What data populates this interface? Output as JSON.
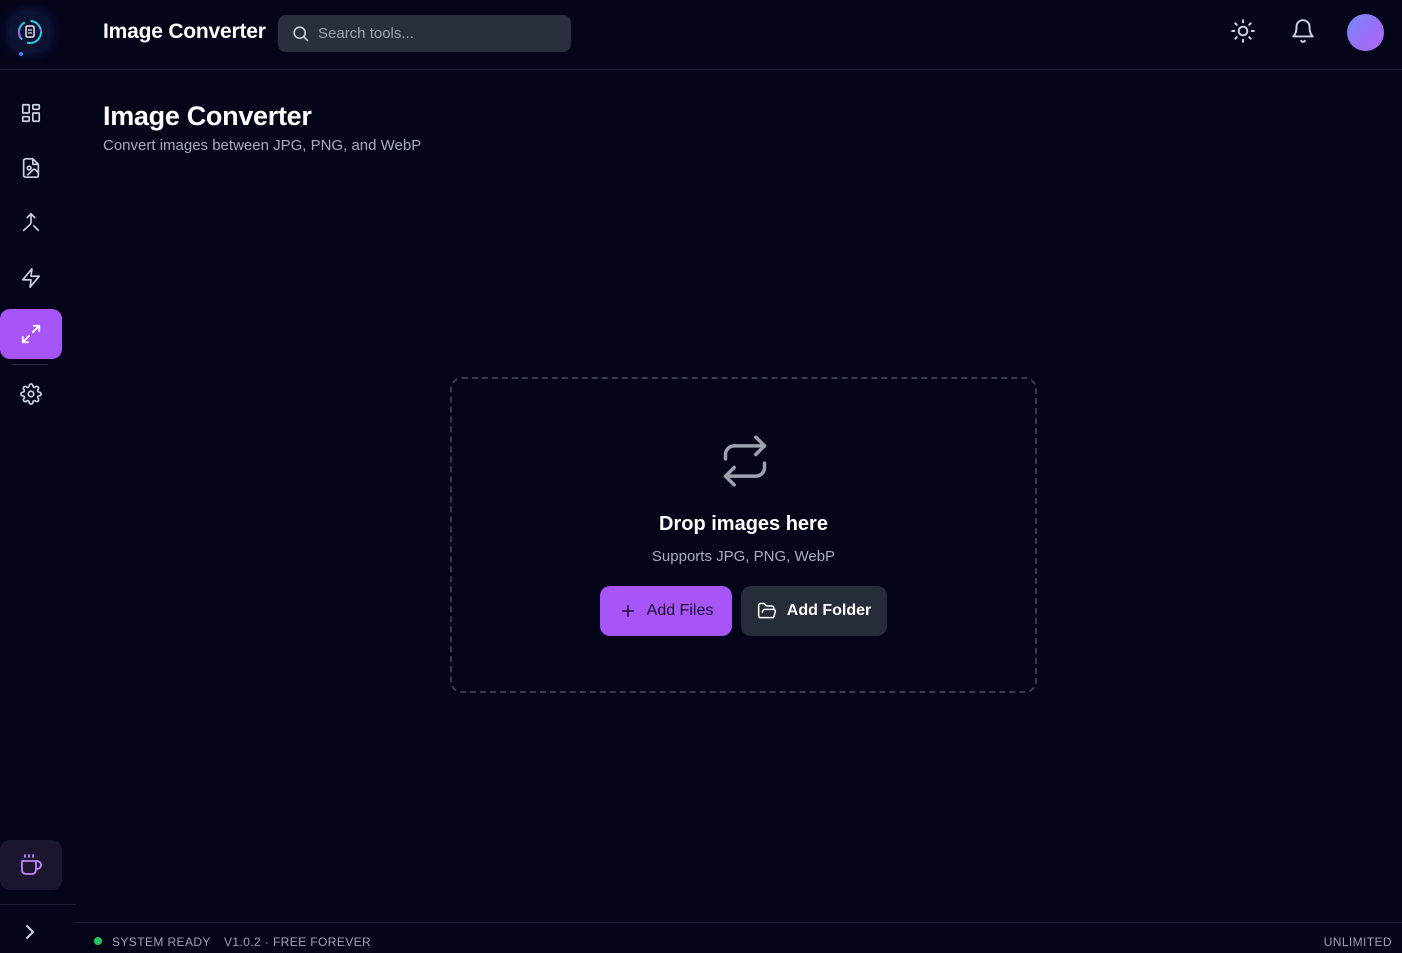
{
  "header": {
    "title": "Image Converter",
    "search_placeholder": "Search tools...",
    "icons": [
      "app-logo-icon",
      "search-icon",
      "sun-icon",
      "bell-icon",
      "avatar"
    ]
  },
  "sidebar": {
    "items": [
      {
        "name": "dashboard",
        "icon": "grid-icon",
        "active": false
      },
      {
        "name": "image-file",
        "icon": "file-image-icon",
        "active": false
      },
      {
        "name": "merge",
        "icon": "merge-icon",
        "active": false
      },
      {
        "name": "quick-actions",
        "icon": "zap-icon",
        "active": false
      },
      {
        "name": "resize",
        "icon": "maximize-icon",
        "active": true
      },
      {
        "name": "settings",
        "icon": "gear-icon",
        "active": false
      }
    ],
    "support_icon": "coffee-icon",
    "expand_icon": "chevron-right-icon"
  },
  "main": {
    "title": "Image Converter",
    "subtitle": "Convert images between JPG, PNG, and WebP",
    "dropzone": {
      "icon": "repeat-icon",
      "title": "Drop images here",
      "subtitle": "Supports JPG, PNG, WebP",
      "add_files_label": "Add Files",
      "add_folder_label": "Add Folder"
    }
  },
  "status_bar": {
    "status": "SYSTEM READY",
    "version": "V1.0.2 · FREE FOREVER",
    "plan": "UNLIMITED",
    "status_color": "#22c55e"
  },
  "colors": {
    "background": "#05051a",
    "accent": "#a855f7",
    "secondary_button": "#262c3a"
  }
}
